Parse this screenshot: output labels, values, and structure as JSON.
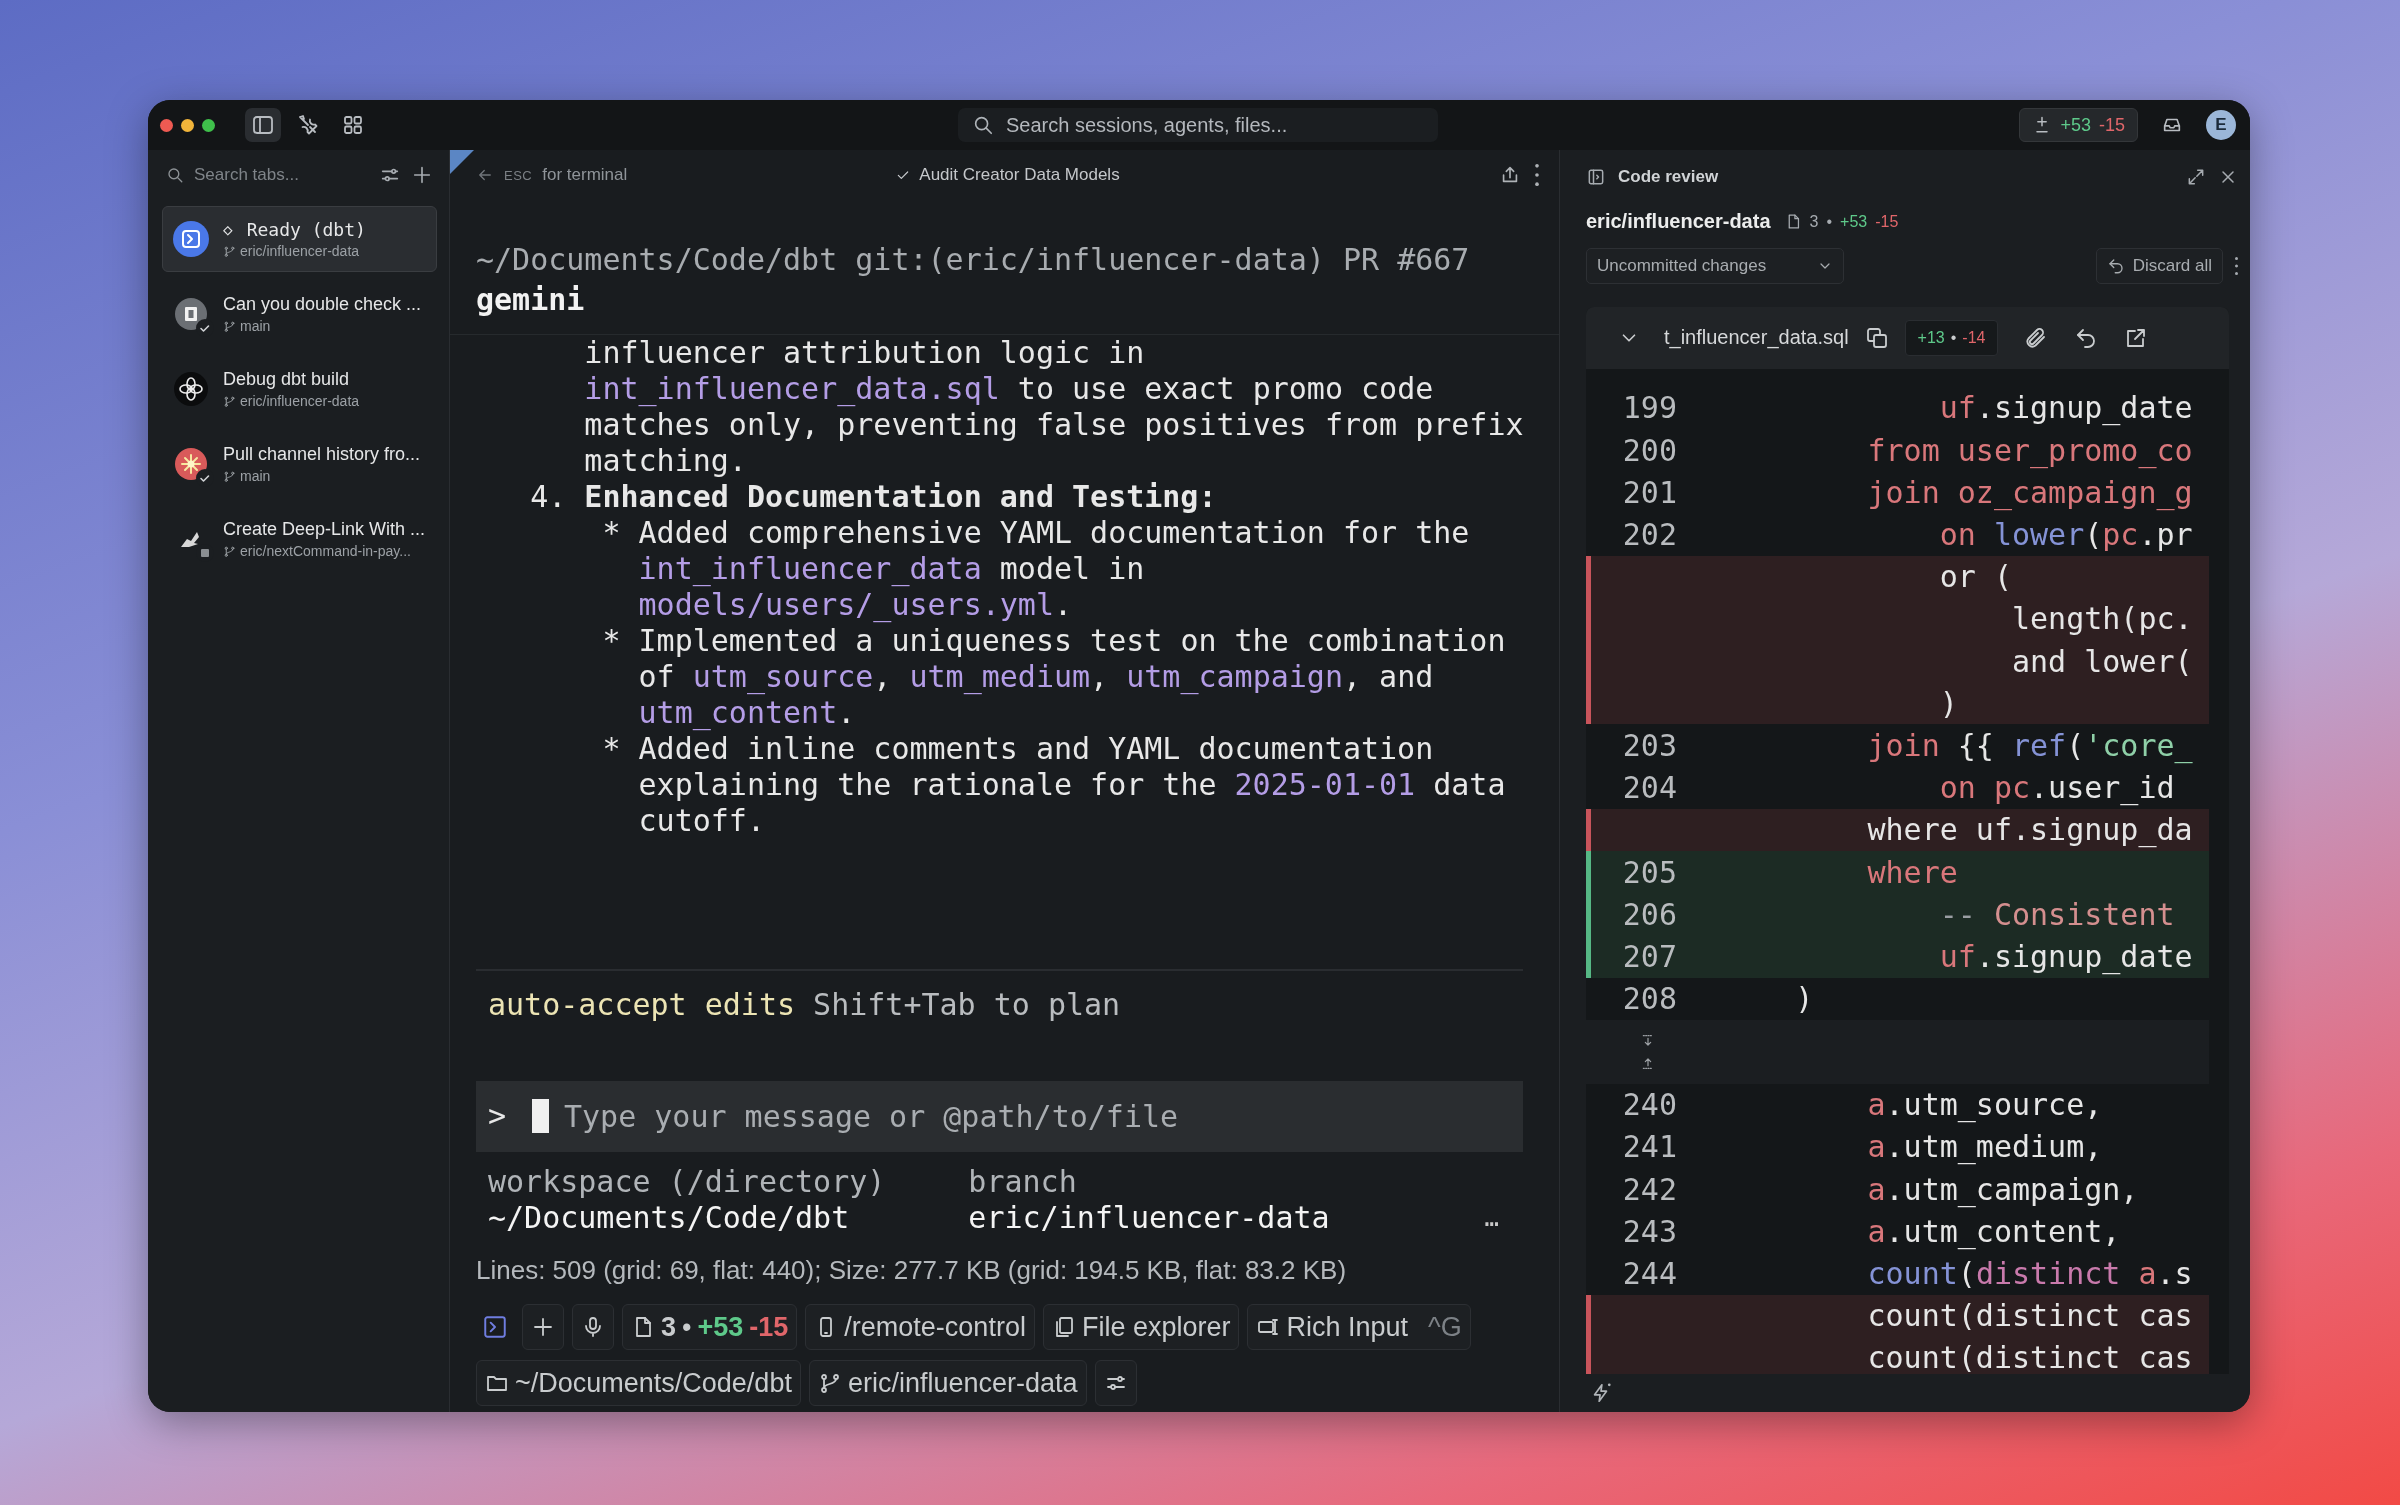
{
  "titlebar": {
    "sidebar_open": true,
    "search": {
      "placeholder": "Search sessions, agents, files..."
    },
    "diff": {
      "added": "+53",
      "removed": "-15"
    },
    "avatar": "E"
  },
  "sidebar": {
    "search": {
      "placeholder": "Search tabs..."
    },
    "tabs": [
      {
        "title": "Ready (dbt)",
        "prefix": "◇",
        "branch": "eric/influencer-data",
        "kind": "terminal",
        "completed": false,
        "stopped": false,
        "selected": true
      },
      {
        "title": "Can you double check ...",
        "branch": "main",
        "kind": "app",
        "completed": true,
        "stopped": false,
        "selected": false
      },
      {
        "title": "Debug dbt build",
        "branch": "eric/influencer-data",
        "kind": "knot",
        "completed": false,
        "stopped": false,
        "selected": false
      },
      {
        "title": "Pull channel history fro...",
        "branch": "main",
        "kind": "burst",
        "completed": true,
        "stopped": false,
        "selected": false
      },
      {
        "title": "Create Deep-Link With ...",
        "branch": "eric/nextCommand-in-pay...",
        "kind": "bird",
        "completed": false,
        "stopped": true,
        "selected": false
      }
    ]
  },
  "session": {
    "header": {
      "key": "ESC",
      "hint": "for terminal",
      "task": "Audit Creator Data Models",
      "task_done": true
    },
    "terminal": {
      "path": "~/Documents/Code/dbt git:(eric/influencer-data) PR #667",
      "agent": "gemini",
      "blocks": [
        {
          "kind": "continuation",
          "segments": [
            {
              "text": "influencer attribution logic in "
            },
            {
              "text": "int_influencer_data.sql",
              "kind": "code"
            },
            {
              "text": " to use exact promo code matches only, preventing false positives from prefix matching."
            }
          ]
        },
        {
          "kind": "numbered",
          "marker": "4.",
          "segments": [
            {
              "text": "Enhanced Documentation and Testing:"
            }
          ]
        },
        {
          "kind": "bullet",
          "marker": "*",
          "segments": [
            {
              "text": "Added comprehensive YAML documentation for the "
            },
            {
              "text": "int_influencer_data",
              "kind": "code"
            },
            {
              "text": " model in "
            },
            {
              "text": "models/users/_users.yml",
              "kind": "code"
            },
            {
              "text": "."
            }
          ]
        },
        {
          "kind": "bullet",
          "marker": "*",
          "segments": [
            {
              "text": "Implemented a uniqueness test on the combination of "
            },
            {
              "text": "utm_source",
              "kind": "code"
            },
            {
              "text": ", "
            },
            {
              "text": "utm_medium",
              "kind": "code"
            },
            {
              "text": ", "
            },
            {
              "text": "utm_campaign",
              "kind": "code"
            },
            {
              "text": ", and "
            },
            {
              "text": "utm_content",
              "kind": "code"
            },
            {
              "text": "."
            }
          ]
        },
        {
          "kind": "bullet",
          "marker": "*",
          "segments": [
            {
              "text": "Added inline comments and YAML documentation explaining the rationale for the "
            },
            {
              "text": "2025-01-01",
              "kind": "code"
            },
            {
              "text": " data cutoff."
            }
          ]
        }
      ]
    },
    "mode": {
      "label": "auto-accept edits",
      "hint": "Shift+Tab to plan"
    },
    "input": {
      "prompt": ">",
      "placeholder": "Type your message or @path/to/file"
    },
    "info": {
      "columns": [
        {
          "label": "workspace (/directory)",
          "value": "~/Documents/Code/dbt"
        },
        {
          "label": "branch",
          "value": "eric/influencer-data"
        }
      ],
      "more": "…"
    },
    "stats": "Lines: 509 (grid: 69, flat: 440); Size: 277.7 KB (grid: 194.5 KB, flat: 83.2 KB)",
    "toolbar": [
      {
        "kind": "terminal"
      },
      {
        "kind": "add"
      },
      {
        "kind": "mic"
      },
      {
        "kind": "changes",
        "count": "3",
        "sep": "•",
        "added": "+53",
        "removed": "-15"
      },
      {
        "kind": "remote",
        "label": "/remote-control"
      },
      {
        "kind": "files",
        "label": "File explorer"
      },
      {
        "kind": "rich",
        "label": "Rich Input",
        "shortcut": "^G"
      }
    ],
    "footer": [
      {
        "kind": "folder",
        "label": "~/Documents/Code/dbt"
      },
      {
        "kind": "branch",
        "label": "eric/influencer-data"
      },
      {
        "kind": "settings"
      }
    ]
  },
  "review": {
    "title": "Code review",
    "branch": "eric/influencer-data",
    "files": "3",
    "sep": "•",
    "added": "+53",
    "removed": "-15",
    "scope": "Uncommitted changes",
    "discard": "Discard all",
    "file": {
      "name": "t_influencer_data.sql",
      "expanded": true,
      "added": "+13",
      "sep": "•",
      "removed": "-14"
    },
    "lines": [
      {
        "kind": "context",
        "number": "199",
        "tokens": [
          {
            "text": "            uf",
            "kind": "keyword"
          },
          {
            "text": ".signup_date"
          }
        ]
      },
      {
        "kind": "context",
        "number": "200",
        "tokens": [
          {
            "text": "        from user_promo_co",
            "kind": "keyword"
          }
        ]
      },
      {
        "kind": "context",
        "number": "201",
        "tokens": [
          {
            "text": "        join oz_campaign_g",
            "kind": "keyword"
          }
        ]
      },
      {
        "kind": "context",
        "number": "202",
        "tokens": [
          {
            "text": "            on ",
            "kind": "keyword"
          },
          {
            "text": "lower",
            "kind": "function"
          },
          {
            "text": "("
          },
          {
            "text": "pc",
            "kind": "keyword"
          },
          {
            "text": ".pr"
          }
        ]
      },
      {
        "kind": "removed",
        "tokens": [
          {
            "text": "            or ("
          }
        ]
      },
      {
        "kind": "removed",
        "tokens": [
          {
            "text": "                length(pc."
          }
        ]
      },
      {
        "kind": "removed",
        "tokens": [
          {
            "text": "                and lower("
          }
        ]
      },
      {
        "kind": "removed",
        "tokens": [
          {
            "text": "            )"
          }
        ]
      },
      {
        "kind": "context",
        "number": "203",
        "tokens": [
          {
            "text": "        join",
            "kind": "keyword"
          },
          {
            "text": " {{ "
          },
          {
            "text": "ref",
            "kind": "function"
          },
          {
            "text": "("
          },
          {
            "text": "'core_",
            "kind": "string"
          }
        ]
      },
      {
        "kind": "context",
        "number": "204",
        "tokens": [
          {
            "text": "            on pc",
            "kind": "keyword"
          },
          {
            "text": ".user_id"
          }
        ]
      },
      {
        "kind": "removed",
        "tokens": [
          {
            "text": "        where uf.signup_da"
          }
        ]
      },
      {
        "kind": "added",
        "number": "205",
        "tokens": [
          {
            "text": "        where",
            "kind": "keyword"
          }
        ]
      },
      {
        "kind": "added",
        "number": "206",
        "tokens": [
          {
            "text": "            --",
            "kind": "punct"
          },
          {
            "text": " Consistent",
            "kind": "comment"
          }
        ]
      },
      {
        "kind": "added",
        "number": "207",
        "tokens": [
          {
            "text": "            uf",
            "kind": "keyword"
          },
          {
            "text": ".signup_date"
          }
        ]
      },
      {
        "kind": "context",
        "number": "208",
        "tokens": [
          {
            "text": "    )"
          }
        ]
      },
      {
        "kind": "expander"
      },
      {
        "kind": "context",
        "number": "240",
        "tokens": [
          {
            "text": "        a",
            "kind": "keyword"
          },
          {
            "text": ".utm_source,"
          }
        ]
      },
      {
        "kind": "context",
        "number": "241",
        "tokens": [
          {
            "text": "        a",
            "kind": "keyword"
          },
          {
            "text": ".utm_medium,"
          }
        ]
      },
      {
        "kind": "context",
        "number": "242",
        "tokens": [
          {
            "text": "        a",
            "kind": "keyword"
          },
          {
            "text": ".utm_campaign,"
          }
        ]
      },
      {
        "kind": "context",
        "number": "243",
        "tokens": [
          {
            "text": "        a",
            "kind": "keyword"
          },
          {
            "text": ".utm_content,"
          }
        ]
      },
      {
        "kind": "context",
        "number": "244",
        "tokens": [
          {
            "text": "        count",
            "kind": "function"
          },
          {
            "text": "("
          },
          {
            "text": "distinct ",
            "kind": "builtin"
          },
          {
            "text": "a",
            "kind": "keyword"
          },
          {
            "text": ".s"
          }
        ]
      },
      {
        "kind": "removed",
        "tokens": [
          {
            "text": "        count(distinct cas"
          }
        ]
      },
      {
        "kind": "removed",
        "tokens": [
          {
            "text": "        count(distinct cas"
          }
        ]
      }
    ]
  }
}
